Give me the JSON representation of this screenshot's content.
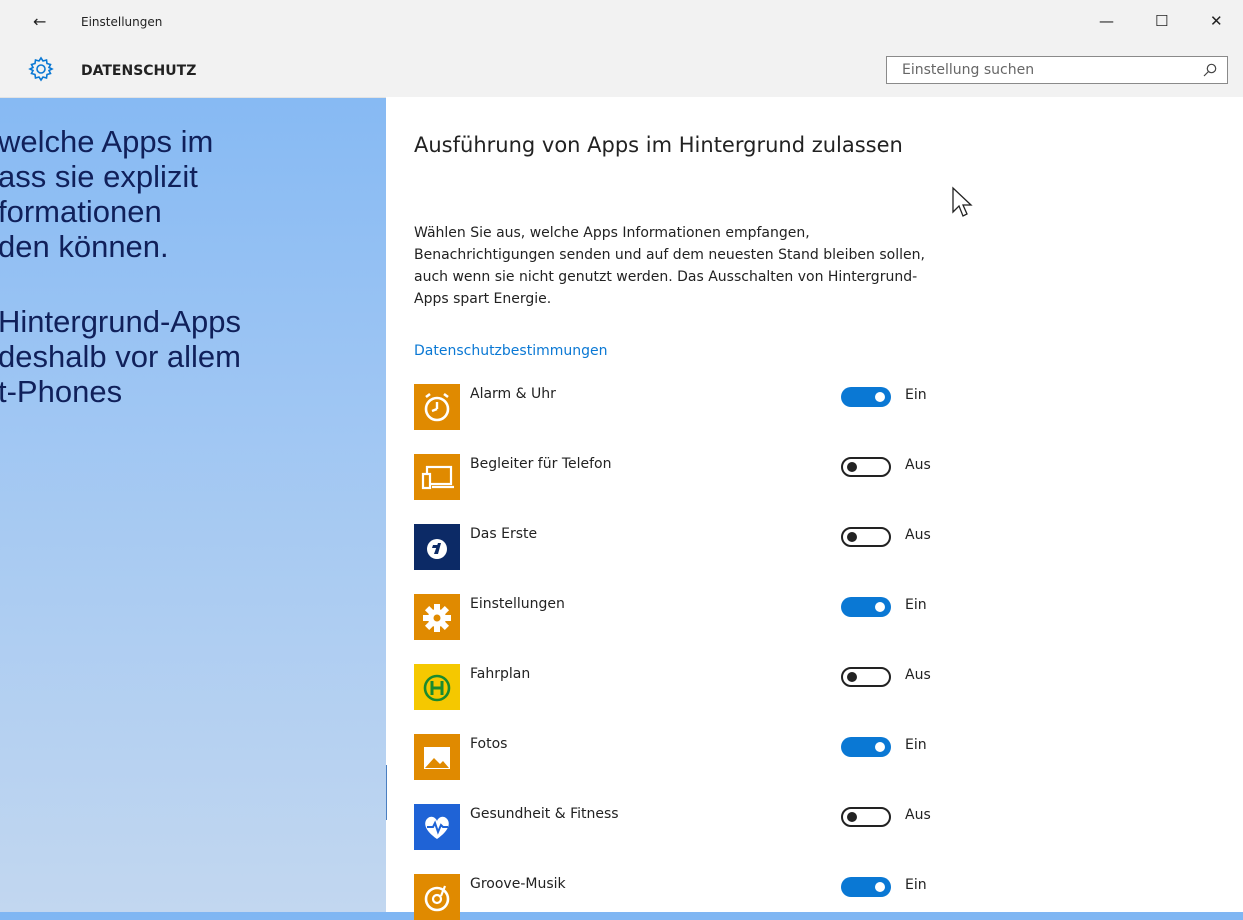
{
  "window": {
    "title": "Einstellungen",
    "back_glyph": "←",
    "minimize_glyph": "—",
    "maximize_glyph": "☐",
    "close_glyph": "✕"
  },
  "header": {
    "section": "DATENSCHUTZ",
    "search_placeholder": "Einstellung suchen"
  },
  "background_slide": {
    "lines_block1": [
      "welche Apps im",
      "ass sie explizit",
      "formationen",
      "den können."
    ],
    "lines_block2": [
      "Hintergrund-Apps",
      "deshalb vor allem",
      "t-Phones"
    ]
  },
  "panel": {
    "heading": "Ausführung von Apps im Hintergrund zulassen",
    "description": "Wählen Sie aus, welche Apps Informationen empfangen, Benachrichtigungen senden und auf dem neuesten Stand bleiben sollen, auch wenn sie nicht genutzt werden. Das Ausschalten von Hintergrund-Apps spart Energie.",
    "privacy_link": "Datenschutzbestimmungen"
  },
  "apps": [
    {
      "name": "Alarm & Uhr",
      "on": true,
      "state": "Ein",
      "icon": "alarm-clock-icon",
      "color": "#e08a00"
    },
    {
      "name": "Begleiter für Telefon",
      "on": false,
      "state": "Aus",
      "icon": "phone-companion-icon",
      "color": "#e08a00"
    },
    {
      "name": "Das Erste",
      "on": false,
      "state": "Aus",
      "icon": "das-erste-icon",
      "color": "#0c2a66"
    },
    {
      "name": "Einstellungen",
      "on": true,
      "state": "Ein",
      "icon": "gear-icon",
      "color": "#e08a00"
    },
    {
      "name": "Fahrplan",
      "on": false,
      "state": "Aus",
      "icon": "bus-stop-icon",
      "color": "#f5c800"
    },
    {
      "name": "Fotos",
      "on": true,
      "state": "Ein",
      "icon": "photos-icon",
      "color": "#e08a00"
    },
    {
      "name": "Gesundheit & Fitness",
      "on": false,
      "state": "Aus",
      "icon": "heart-pulse-icon",
      "color": "#1f63d6"
    },
    {
      "name": "Groove-Musik",
      "on": true,
      "state": "Ein",
      "icon": "groove-music-icon",
      "color": "#e08a00"
    }
  ]
}
